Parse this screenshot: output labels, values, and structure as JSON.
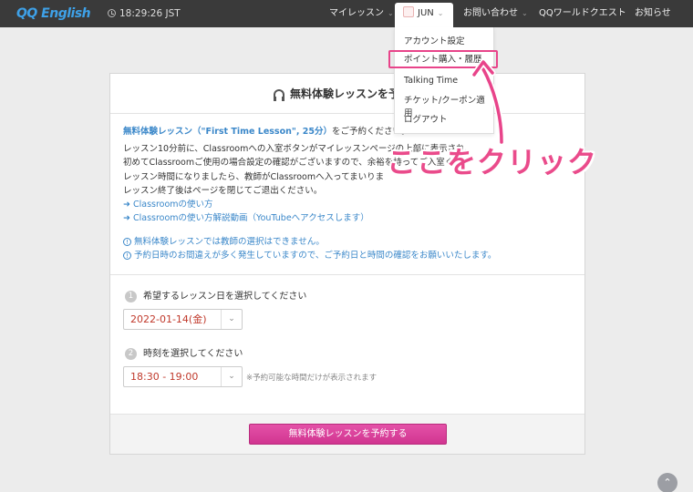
{
  "header": {
    "logo_text": "QQ English",
    "clock": "18:29:26 JST",
    "nav": {
      "my_lesson": "マイレッスン",
      "user": "JUN",
      "contact": "お問い合わせ",
      "quest": "QQワールドクエスト",
      "news": "お知らせ"
    }
  },
  "dropdown": {
    "items": [
      "アカウント設定",
      "ポイント購入・履歴",
      "Talking Time",
      "チケット/クーポン適用",
      "ログアウト"
    ]
  },
  "panel": {
    "title": "無料体験レッスンを予約し",
    "intro": {
      "lesson_name": "無料体験レッスン（\"First Time Lesson\", 25分）",
      "lesson_suffix": "をご予約ください。",
      "line2": "レッスン10分前に、Classroomへの入室ボタンがマイレッスンページの上部に表示され、",
      "line3": "初めてClassroomご使用の場合設定の確認がございますので、余裕を持ってご入室くだ",
      "line4": "レッスン時間になりましたら、教師がClassroomへ入ってまいりま",
      "line5": "レッスン終了後はページを閉じてご退出ください。",
      "link1": "Classroomの使い方",
      "link2": "Classroomの使い方解説動画（YouTubeへアクセスします）",
      "note1": "無料体験レッスンでは教師の選択はできません。",
      "note2": "予約日時のお間違えが多く発生していますので、ご予約日と時間の確認をお願いいたします。"
    },
    "step1": {
      "num": "1",
      "label": "希望するレッスン日を選択してください",
      "value": "2022-01-14(金)"
    },
    "step2": {
      "num": "2",
      "label": "時刻を選択してください",
      "value": "18:30 - 19:00",
      "note": "※予約可能な時間だけが表示されます"
    },
    "submit_label": "無料体験レッスンを予約する"
  },
  "annotation": {
    "text": "ここをクリック"
  },
  "colors": {
    "accent_pink": "#e8448a",
    "link_blue": "#3a87c9",
    "button_pink": "#dd3f9a",
    "header_bg": "#3a3a3a"
  },
  "icons": [
    "clock-icon",
    "avatar",
    "chevron-down-icon",
    "headphone-icon",
    "arrow-right-icon",
    "info-icon",
    "chevron-up-icon"
  ]
}
